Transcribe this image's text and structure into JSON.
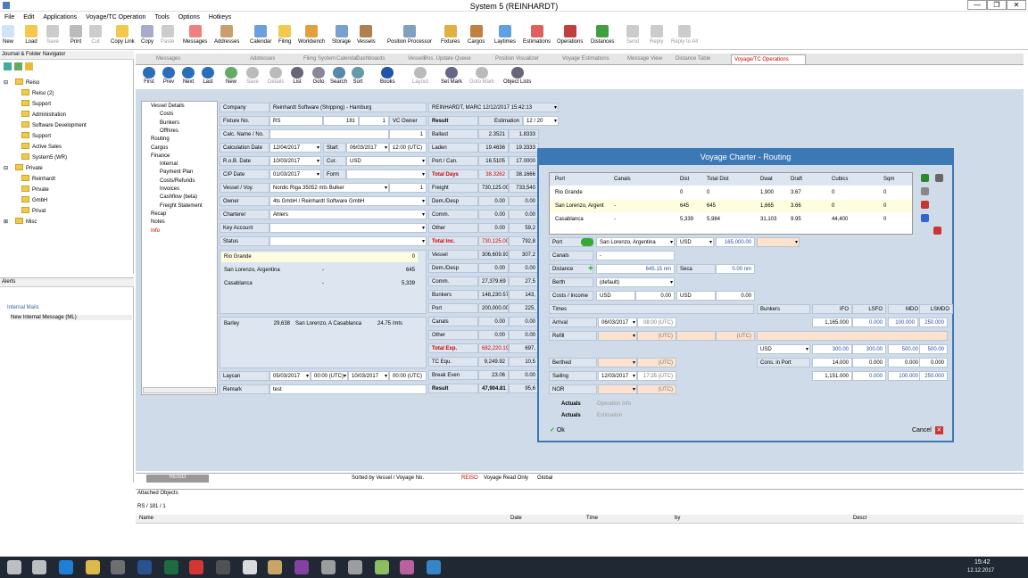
{
  "window": {
    "title": "System 5 (REINHARDT)"
  },
  "menu": [
    "File",
    "Edit",
    "Applications",
    "Voyage/TC Operation",
    "Tools",
    "Options",
    "Hotkeys"
  ],
  "ribbon": [
    {
      "label": "New",
      "color": "#d0e4f7"
    },
    {
      "label": "Load",
      "color": "#f2c94c"
    },
    {
      "label": "Save",
      "color": "#ccc",
      "dis": true
    },
    {
      "label": "Print",
      "color": "#bbb"
    },
    {
      "label": "Cut",
      "color": "#ccc",
      "dis": true
    },
    {
      "label": "Copy Link",
      "color": "#f2c94c"
    },
    {
      "label": "Copy",
      "color": "#aac"
    },
    {
      "label": "Paste",
      "color": "#ccc",
      "dis": true
    },
    {
      "label": "Messages",
      "color": "#f08080"
    },
    {
      "label": "Addresses",
      "color": "#c8a070"
    },
    {
      "label": "Calendar",
      "color": "#6aa0e0"
    },
    {
      "label": "Filing",
      "color": "#f2c94c"
    },
    {
      "label": "Workbench",
      "color": "#e0a040"
    },
    {
      "label": "Storage",
      "color": "#7aa0d0"
    },
    {
      "label": "Vessels",
      "color": "#b08050"
    },
    {
      "label": "Position Processor",
      "color": "#80a0c0"
    },
    {
      "label": "Fixtures",
      "color": "#e0b040"
    },
    {
      "label": "Cargos",
      "color": "#c08040"
    },
    {
      "label": "Laytimes",
      "color": "#60a0e0"
    },
    {
      "label": "Estimations",
      "color": "#e06060"
    },
    {
      "label": "Operations",
      "color": "#c04040"
    },
    {
      "label": "Distances",
      "color": "#40a040"
    },
    {
      "label": "Send",
      "color": "#ccc",
      "dis": true
    },
    {
      "label": "Reply",
      "color": "#ccc",
      "dis": true
    },
    {
      "label": "Reply to All",
      "color": "#ccc",
      "dis": true
    }
  ],
  "nav": {
    "title": "Journal & Folder Navigator",
    "items": [
      {
        "label": "Reiso",
        "lvl": 0,
        "exp": "⊟"
      },
      {
        "label": "Reiso (2)",
        "lvl": 1
      },
      {
        "label": "Support",
        "lvl": 1
      },
      {
        "label": "Administration",
        "lvl": 1
      },
      {
        "label": "Software Development",
        "lvl": 1
      },
      {
        "label": "Support",
        "lvl": 1
      },
      {
        "label": "Active Sales",
        "lvl": 1
      },
      {
        "label": "System5 (WR)",
        "lvl": 1
      },
      {
        "label": "Private",
        "lvl": 0,
        "exp": "⊟"
      },
      {
        "label": "Reinhardt",
        "lvl": 1
      },
      {
        "label": "Private",
        "lvl": 1
      },
      {
        "label": "GmbH",
        "lvl": 1
      },
      {
        "label": "Privat",
        "lvl": 1
      },
      {
        "label": "Misc",
        "lvl": 0,
        "exp": "⊞"
      }
    ]
  },
  "alerts": {
    "title": "Alerts",
    "items": [
      "Internal Mails",
      "New Internal Message (ML)"
    ]
  },
  "tabs": [
    "Messages",
    "Addresses",
    "Filing System",
    "Calendar",
    "Dashboards",
    "Vessels",
    "Pos. Update Queue",
    "Position Visualizer",
    "Voyage Estimations",
    "Message View",
    "Distance Table",
    "Voyage/TC Operations"
  ],
  "vtoolbar": [
    {
      "label": "First"
    },
    {
      "label": "Prev"
    },
    {
      "label": "Next"
    },
    {
      "label": "Last"
    },
    {
      "label": "New"
    },
    {
      "label": "Save",
      "dis": true
    },
    {
      "label": "Details",
      "dis": true
    },
    {
      "label": "List"
    },
    {
      "label": "Goto"
    },
    {
      "label": "Search"
    },
    {
      "label": "Sort"
    },
    {
      "label": "Books"
    },
    {
      "label": "Layout",
      "dis": true
    },
    {
      "label": "Set Mark"
    },
    {
      "label": "Goto Mark",
      "dis": true
    },
    {
      "label": "Object Lists"
    }
  ],
  "lefttree": [
    "Vessel Details",
    "Costs",
    "Bunkers",
    "Offhires",
    "Routing",
    "Cargos",
    "Finance",
    "Internal",
    "Payment Plan",
    "Costs/Refunds",
    "Invoices",
    "Cashflow (beta)",
    "Freight Statement",
    "Recap",
    "Notes",
    "Info"
  ],
  "form": {
    "company": "Reinhardt Software (Shipping) - Hamburg",
    "user": "REINHARDT, MARC  12/12/2017 15:42:13",
    "fixture": "RS",
    "fixture_no": "181",
    "fixture_seq": "1",
    "vc_owner": "VC Owner",
    "result_lbl": "Result",
    "estimation": "Estimation",
    "est_no": "12 / 20",
    "calc_name": "1",
    "calc_date": "12/04/2017",
    "start": "06/03/2017",
    "start_time": "12:00 (UTC)",
    "rob_date": "10/03/2017",
    "cur": "USD",
    "cp_date": "01/03/2017",
    "form": "",
    "vessel": "Nordic Riga  35052 mts Bulker",
    "vessel_no": "1",
    "owner": "4ts GmbH / Reinhardt Software GmbH",
    "charterer": "Ahlers",
    "port_rio": "Rio Grande",
    "port_rio_v": "0",
    "port_sl": "San Lorenzo, Argentina",
    "port_sl_d": "-",
    "port_sl_v": "645",
    "port_ca": "Casablanca",
    "port_ca_d": "-",
    "port_ca_v": "5,339",
    "cargo": "Barley",
    "cargo_qty": "29,638",
    "cargo_route": "San Lorenzo, A   Casablanca",
    "cargo_rate": "24.75 /mts",
    "laycan_from": "05/03/2017",
    "laycan_ft": "00:00 (UTC)",
    "laycan_to": "10/03/2017",
    "laycan_tt": "00:00 (UTC)",
    "remark": "test",
    "labels": {
      "company": "Company",
      "fixture": "Fixture No.",
      "calc": "Calc. Name / No.",
      "calc_date": "Calculation Date",
      "start": "Start",
      "rob": "R.o.B. Date",
      "cur": "Cur.",
      "cp": "C/P Date",
      "form": "Form",
      "vessel": "Vessel / Voy.",
      "owner": "Owner",
      "charterer": "Charterer",
      "key": "Key Account",
      "status": "Status",
      "laycan": "Laycan",
      "remark": "Remark"
    },
    "fin": [
      {
        "l": "Ballast",
        "v": "2.3521",
        "v2": "1.8333"
      },
      {
        "l": "Laden",
        "v": "19.4636",
        "v2": "19.3333"
      },
      {
        "l": "Port / Can.",
        "v": "16.5105",
        "v2": "17.0000"
      },
      {
        "l": "Total Days",
        "v": "38.3262",
        "v2": "38.1666",
        "red": true
      },
      {
        "l": "Freight",
        "v": "730,125.00",
        "v2": "733,540"
      },
      {
        "l": "Dem./Desp",
        "v": "0.00",
        "v2": "0.00"
      },
      {
        "l": "Comm.",
        "v": "0.00",
        "v2": "0.00"
      },
      {
        "l": "Other",
        "v": "0.00",
        "v2": "59,2"
      },
      {
        "l": "Total Inc.",
        "v": "730,125.00",
        "v2": "792,8",
        "red": true
      },
      {
        "l": "Vessel",
        "v": "306,609.93",
        "v2": "307,2"
      },
      {
        "l": "Dem./Desp",
        "v": "0.00",
        "v2": "0.00"
      },
      {
        "l": "Comm.",
        "v": "27,379.69",
        "v2": "27,5"
      },
      {
        "l": "Bunkers",
        "v": "148,230.57",
        "v2": "143,"
      },
      {
        "l": "Port",
        "v": "200,000.00",
        "v2": "225,"
      },
      {
        "l": "Canals",
        "v": "0.00",
        "v2": "0.00"
      },
      {
        "l": "Other",
        "v": "0.00",
        "v2": "0.00"
      },
      {
        "l": "Total Exp.",
        "v": "682,220.19",
        "v2": "697,",
        "red": true
      },
      {
        "l": "TC Equ.",
        "v": "9,249.92",
        "v2": "10,5"
      },
      {
        "l": "Break Even",
        "v": "23.06",
        "v2": "0.00"
      },
      {
        "l": "Result",
        "v": "47,904.81",
        "v2": "95,6",
        "bold": true
      }
    ]
  },
  "dialog": {
    "title": "Voyage Charter - Routing",
    "headers": [
      "Port",
      "Canals",
      "Dist",
      "Total Dist",
      "Dwat",
      "Draft",
      "Cubics",
      "Sqm"
    ],
    "rows": [
      [
        "Rio Grande",
        "",
        "0",
        "0",
        "1,900",
        "3.67",
        "0",
        "0"
      ],
      [
        "San Lorenzo, Argent",
        "-",
        "645",
        "645",
        "1,665",
        "3.66",
        "0",
        "0"
      ],
      [
        "Casablanca",
        "-",
        "5,339",
        "5,984",
        "31,103",
        "9.95",
        "44,400",
        "0"
      ]
    ],
    "port": "San Lorenzo, Argentina",
    "port_cur": "USD",
    "port_cost": "165,000.00",
    "canals": "-",
    "distance": "645.15 nm",
    "seca": "0.00 nm",
    "berth": "(default)",
    "ci_cur": "USD",
    "ci_v": "0.00",
    "ci_cur2": "USD",
    "ci_v2": "0.00",
    "labels": {
      "port": "Port",
      "canals": "Canals",
      "distance": "Distance",
      "seca": "Seca",
      "berth": "Berth",
      "costs": "Costs / Income",
      "times": "Times",
      "bunkers": "Bunkers",
      "arrival": "Arrival",
      "refill": "Refill",
      "berthed": "Berthed",
      "sailing": "Sailing",
      "nor": "NOR",
      "cons": "Cons. in Port",
      "actuals": "Actuals",
      "opinfo": "Operation Info",
      "estim": "Estimation",
      "ok": "Ok",
      "cancel": "Cancel"
    },
    "arrival_d": "06/03/2017",
    "arrival_t": "08:00 (UTC)",
    "refill_t": "(UTC)",
    "refill_t2": "(UTC)",
    "berthed_t": "(UTC)",
    "sailing_d": "12/03/2017",
    "sailing_t": "17:25 (UTC)",
    "nor_t": "(UTC)",
    "bunk_heads": [
      "IFO",
      "LSFO",
      "MDO",
      "LSMDO"
    ],
    "bunk_rows": [
      [
        "1,165.000",
        "0.000",
        "100.000",
        "250.000"
      ],
      [
        "USD",
        "300.00",
        "300.00",
        "500.00",
        "500.00"
      ],
      [
        "Cons. in Port",
        "14.000",
        "0.000",
        "0.000",
        "0.000"
      ],
      [
        "",
        "1,151.000",
        "0.000",
        "100.000",
        "250.000"
      ]
    ]
  },
  "status": {
    "book": "REISO",
    "sort": "Sorted by Vessel / Voyage No.",
    "reiso": "REISO",
    "voyage": "Voyage Read Only",
    "global": "Global"
  },
  "attach": {
    "title": "Attached Objects",
    "path": "RS / 181 / 1",
    "cols": [
      "Name",
      "Date",
      "Time",
      "by",
      "Descr"
    ]
  },
  "clock": {
    "time": "15:42",
    "date": "12.12.2017"
  }
}
